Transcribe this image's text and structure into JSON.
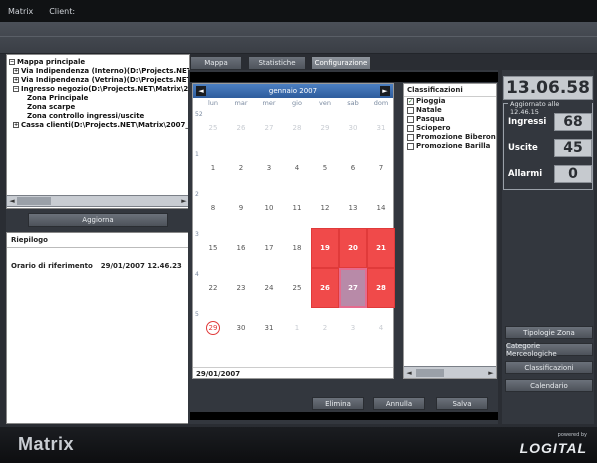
{
  "titlebar": {
    "app": "Matrix",
    "client": "Client:"
  },
  "tree": {
    "items": [
      {
        "level": 0,
        "exp": "−",
        "label": "Mappa principale"
      },
      {
        "level": 1,
        "exp": "+",
        "label": "Via Indipendenza (Interno)(D:\\Projects.NET\\"
      },
      {
        "level": 1,
        "exp": "+",
        "label": "Via Indipendenza (Vetrina)(D:\\Projects.NET\\"
      },
      {
        "level": 1,
        "exp": "−",
        "label": "Ingresso negozio(D:\\Projects.NET\\Matrix\\20"
      },
      {
        "level": 2,
        "exp": "",
        "label": "Zona Principale"
      },
      {
        "level": 2,
        "exp": "",
        "label": "Zona scarpe"
      },
      {
        "level": 2,
        "exp": "",
        "label": "Zona controllo ingressi/uscite"
      },
      {
        "level": 1,
        "exp": "+",
        "label": "Cassa clienti(D:\\Projects.NET\\Matrix\\2007_0"
      }
    ]
  },
  "left": {
    "update_button": "Aggiorna",
    "riepilogo_title": "Riepilogo",
    "ref_label": "Orario di riferimento",
    "ref_value": "29/01/2007 12.46.23"
  },
  "tabs": {
    "mappa": "Mappa",
    "statistiche": "Statistiche",
    "configurazione": "Configurazione"
  },
  "calendar": {
    "month": "gennaio 2007",
    "prev": "◄",
    "next": "►",
    "dow": [
      "lun",
      "mar",
      "mer",
      "gio",
      "ven",
      "sab",
      "dom"
    ],
    "weeks": [
      "52",
      "1",
      "2",
      "3",
      "4",
      "5"
    ],
    "days": [
      [
        "25",
        "26",
        "27",
        "28",
        "29",
        "30",
        "31"
      ],
      [
        "1",
        "2",
        "3",
        "4",
        "5",
        "6",
        "7"
      ],
      [
        "8",
        "9",
        "10",
        "11",
        "12",
        "13",
        "14"
      ],
      [
        "15",
        "16",
        "17",
        "18",
        "19",
        "20",
        "21"
      ],
      [
        "22",
        "23",
        "24",
        "25",
        "26",
        "27",
        "28"
      ],
      [
        "29",
        "30",
        "31",
        "1",
        "2",
        "3",
        "4"
      ]
    ],
    "footer": "29/01/2007"
  },
  "classificazioni": {
    "title": "Classificazioni",
    "items": [
      {
        "label": "Pioggia",
        "checked": true
      },
      {
        "label": "Natale",
        "checked": false
      },
      {
        "label": "Pasqua",
        "checked": false
      },
      {
        "label": "Sciopero",
        "checked": false
      },
      {
        "label": "Promozione Biberon",
        "checked": false
      },
      {
        "label": "Promozione Barilla",
        "checked": false
      }
    ]
  },
  "actions": {
    "elimina": "Elimina",
    "annulla": "Annulla",
    "salva": "Salva"
  },
  "right": {
    "clock": "13.06.58",
    "updated": "Aggiornato alle 12.46.15",
    "ingressi_label": "Ingressi",
    "ingressi_value": "68",
    "uscite_label": "Uscite",
    "uscite_value": "45",
    "allarmi_label": "Allarmi",
    "allarmi_value": "0",
    "btn_tipologie": "Tipologie Zona",
    "btn_categorie": "Categorie Merceologiche",
    "btn_classificazioni": "Classificazioni",
    "btn_calendario": "Calendario"
  },
  "footer": {
    "logo": "Matrix",
    "powered": "powered by",
    "brand": "LOGITAL"
  }
}
